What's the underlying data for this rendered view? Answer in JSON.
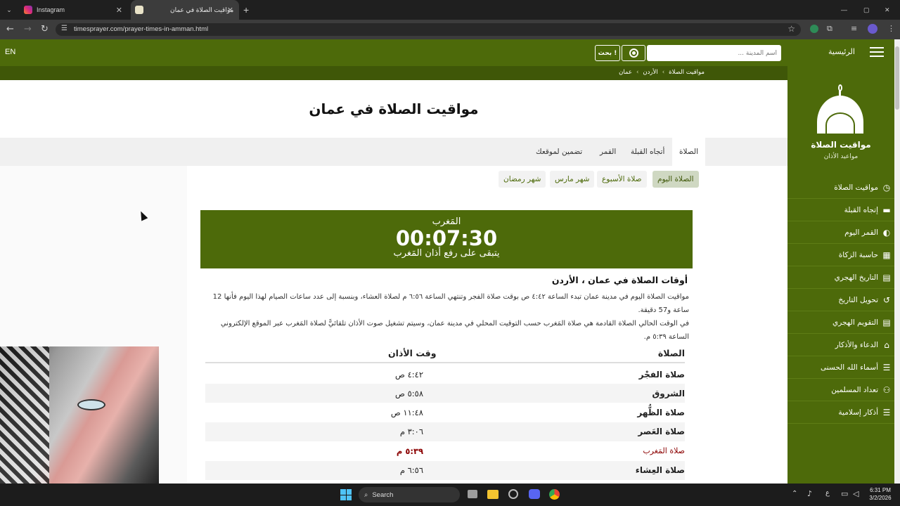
{
  "browser": {
    "tabs": [
      {
        "title": "Instagram",
        "active": false
      },
      {
        "title": "مواقيت الصلاة في عمان",
        "active": true
      }
    ],
    "url": "timesprayer.com/prayer-times-in-amman.html"
  },
  "header": {
    "lang": "EN",
    "search_placeholder": "أسم المدينة ...",
    "search_button": "بحث !",
    "home_label": "الرئيسية"
  },
  "breadcrumb": [
    "مواقيت الصلاة",
    "الأردن",
    "عمان"
  ],
  "page_title": "مواقيت الصلاة في عمان",
  "main_tabs": [
    "الصلاة",
    "أتجاه القبلة",
    "القمر",
    "تضمين لموقعك"
  ],
  "sub_tabs": [
    "الصلاة اليوم",
    "صلاة الأسبوع",
    "شهر مارس",
    "شهر رمضان"
  ],
  "countdown": {
    "prayer": "المَغرب",
    "time": "00:07:30",
    "note": "يتبقى على رفع أذان المَغرب"
  },
  "section": {
    "heading": "أوقات الصلاة في عمان ، الأردن",
    "para1": "مواقيت الصلاة اليوم في مدينة عمان تبدء الساعة ٤:٤٢ ص بوقت صلاة الفجر وتنتهي الساعة ٦:٥٦ م لصلاة العشاء، وبنسبة إلى عدد ساعات الصيام لهذا اليوم فأنها 12 ساعة و57 دقيقة.",
    "para2": "في الوقت الحالي الصلاة القادمة هي صلاة المَغرب حسب التوقيت المحلي في مدينة عمان، وسيتم تشغيل صوت الأذان تلقائيًّ لصلاة المَغرب عبر الموقع الإلكتروني الساعة ٥:٣٩ م."
  },
  "table": {
    "col_prayer": "الصلاة",
    "col_time": "وقت الأذان",
    "rows": [
      {
        "name": "صلاة الفجْر",
        "time": "٤:٤٢ ص"
      },
      {
        "name": "الشروق",
        "time": "٥:٥٨ ص"
      },
      {
        "name": "صلاة الظُّهر",
        "time": "١١:٤٨ ص"
      },
      {
        "name": "صلاة العَصر",
        "time": "٣:٠٦ م"
      },
      {
        "name": "صلاة المَغرب",
        "time": "٥:٣٩ م",
        "highlight": true
      },
      {
        "name": "صلاة العِشاء",
        "time": "٦:٥٦ م"
      }
    ]
  },
  "sidebar": {
    "logo_title": "مواقيت الصلاة",
    "logo_sub": "مواعيد الأذان",
    "items": [
      {
        "label": "مواقيت الصلاة",
        "icon": "clock-icon"
      },
      {
        "label": "إتجاه القبلة",
        "icon": "kaaba-icon"
      },
      {
        "label": "القمر اليوم",
        "icon": "moon-icon"
      },
      {
        "label": "حاسبة الزكاة",
        "icon": "calculator-icon"
      },
      {
        "label": "التاريخ الهجري",
        "icon": "calendar-icon"
      },
      {
        "label": "تحويل التاريخ",
        "icon": "history-icon"
      },
      {
        "label": "التقويم الهجري",
        "icon": "calendar-icon"
      },
      {
        "label": "الدعاء والأذكار",
        "icon": "mosque-icon"
      },
      {
        "label": "أسماء الله الحسنى",
        "icon": "list-icon"
      },
      {
        "label": "تعداد المسلمين",
        "icon": "people-icon"
      },
      {
        "label": "أذكار إسلامية",
        "icon": "list-icon"
      }
    ]
  },
  "taskbar": {
    "search": "Search",
    "time": "6:31 PM",
    "date": "3/2/2026",
    "lang": "ع"
  },
  "colors": {
    "brand": "#4d6a0a",
    "highlight": "#8b0000"
  }
}
